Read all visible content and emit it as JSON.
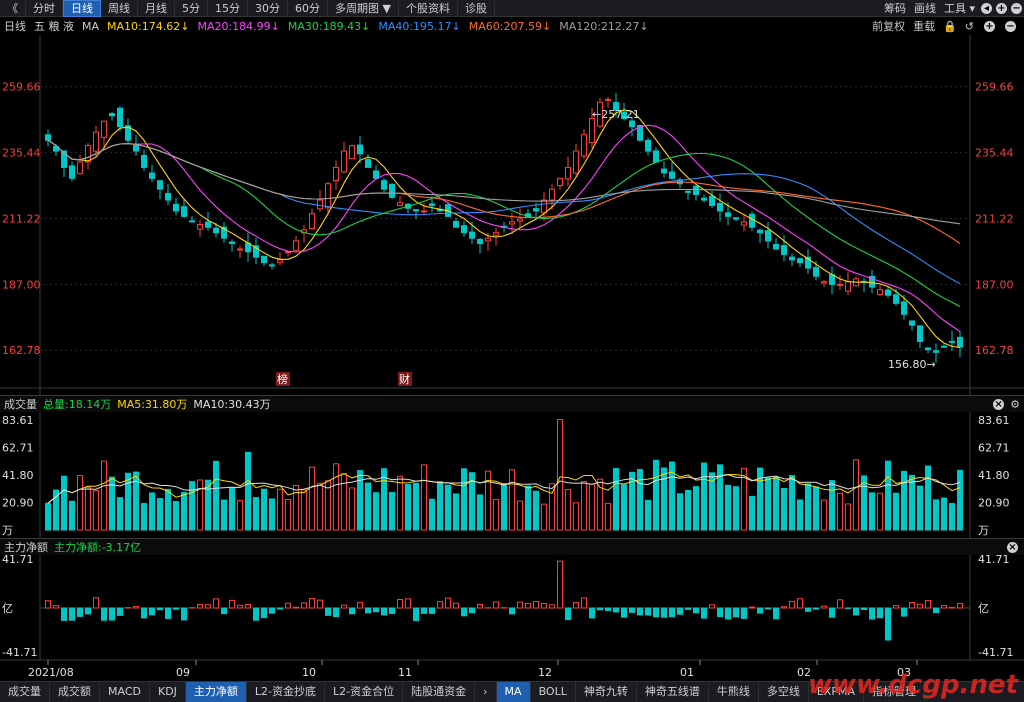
{
  "toolbar": {
    "back": "《",
    "tabs": [
      "分时",
      "日线",
      "周线",
      "月线",
      "5分",
      "15分",
      "30分",
      "60分",
      "多周期图 ▼",
      "个股资料",
      "诊股"
    ],
    "right": [
      "筹码",
      "画线",
      "工具 ▾"
    ],
    "icons": [
      "◂",
      "+",
      "−"
    ]
  },
  "main_header": {
    "period": "日线",
    "stock": "五 粮 液",
    "indicator": "MA",
    "ma": [
      {
        "label": "MA10:174.62",
        "color": "#ffd700"
      },
      {
        "label": "MA20:184.99",
        "color": "#ff40ff"
      },
      {
        "label": "MA30:189.43",
        "color": "#19d24a"
      },
      {
        "label": "MA40:195.17",
        "color": "#2e8fff"
      },
      {
        "label": "MA60:207.59",
        "color": "#ff6a28"
      },
      {
        "label": "MA120:212.27",
        "color": "#a0a0a0"
      }
    ],
    "right": [
      "前复权",
      "重载"
    ]
  },
  "price_axis": [
    "259.66",
    "235.44",
    "211.22",
    "187.00",
    "162.78"
  ],
  "annotations": {
    "high": "257.21",
    "low": "156.80",
    "tag1": "榜",
    "tag2": "财"
  },
  "volume_panel": {
    "title": "成交量",
    "total": "总量:18.14万",
    "ma5": "MA5:31.80万",
    "ma10": "MA10:30.43万",
    "axis": [
      "83.61",
      "62.71",
      "41.80",
      "20.90",
      "万"
    ]
  },
  "flow_panel": {
    "title": "主力净额",
    "value": "主力净额:-3.17亿",
    "axis": [
      "41.71",
      "亿",
      "-41.71"
    ]
  },
  "date_axis": [
    "2021/08",
    "09",
    "10",
    "11",
    "12",
    "01",
    "02",
    "03"
  ],
  "bottom_tabs": [
    "成交量",
    "成交额",
    "MACD",
    "KDJ",
    "主力净额",
    "L2-资金抄底",
    "L2-资金合位",
    "陆股通资金",
    "›",
    "MA",
    "BOLL",
    "神奇九转",
    "神奇五线谱",
    "牛熊线",
    "多空线",
    "EXPMA",
    "指标管理"
  ],
  "watermark": "www.dcgp.net",
  "chart_data": {
    "type": "candlestick",
    "ylim": [
      150,
      275
    ],
    "close_series": [
      240,
      236,
      230,
      226,
      232,
      238,
      243,
      247,
      249,
      245,
      240,
      236,
      230,
      226,
      222,
      218,
      214,
      212,
      210,
      209,
      208,
      206,
      204,
      202,
      200,
      199,
      197,
      195,
      194,
      196,
      199,
      203,
      207,
      213,
      218,
      224,
      230,
      236,
      238,
      235,
      230,
      226,
      222,
      219,
      217,
      215,
      214,
      214,
      216,
      214,
      212,
      208,
      206,
      204,
      202,
      204,
      206,
      208,
      210,
      211,
      212,
      214,
      218,
      222,
      226,
      230,
      236,
      242,
      248,
      254,
      255,
      251,
      248,
      245,
      240,
      236,
      232,
      228,
      226,
      224,
      221,
      220,
      218,
      216,
      214,
      212,
      211,
      210,
      208,
      206,
      203,
      200,
      198,
      196,
      195,
      193,
      190,
      188,
      187,
      187,
      188,
      189,
      188,
      186,
      185,
      183,
      180,
      176,
      172,
      166,
      163,
      162,
      164,
      166,
      164
    ]
  }
}
